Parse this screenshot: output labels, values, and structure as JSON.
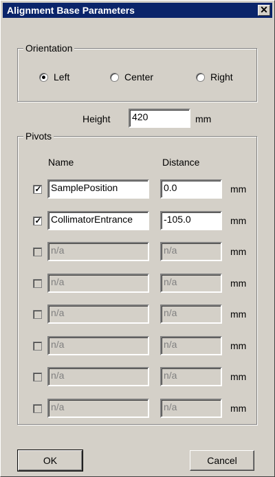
{
  "window": {
    "title": "Alignment Base Parameters",
    "close_glyph": "✕"
  },
  "orientation": {
    "legend": "Orientation",
    "options": [
      {
        "label": "Left",
        "checked": true
      },
      {
        "label": "Center",
        "checked": false
      },
      {
        "label": "Right",
        "checked": false
      }
    ]
  },
  "height": {
    "label": "Height",
    "value": "420",
    "unit": "mm"
  },
  "pivots": {
    "legend": "Pivots",
    "col_name": "Name",
    "col_distance": "Distance",
    "rows": [
      {
        "checked": true,
        "name": "SamplePosition",
        "distance": "0.0",
        "unit": "mm",
        "enabled": true
      },
      {
        "checked": true,
        "name": "CollimatorEntrance",
        "distance": "-105.0",
        "unit": "mm",
        "enabled": true
      },
      {
        "checked": false,
        "name": "n/a",
        "distance": "n/a",
        "unit": "mm",
        "enabled": false
      },
      {
        "checked": false,
        "name": "n/a",
        "distance": "n/a",
        "unit": "mm",
        "enabled": false
      },
      {
        "checked": false,
        "name": "n/a",
        "distance": "n/a",
        "unit": "mm",
        "enabled": false
      },
      {
        "checked": false,
        "name": "n/a",
        "distance": "n/a",
        "unit": "mm",
        "enabled": false
      },
      {
        "checked": false,
        "name": "n/a",
        "distance": "n/a",
        "unit": "mm",
        "enabled": false
      },
      {
        "checked": false,
        "name": "n/a",
        "distance": "n/a",
        "unit": "mm",
        "enabled": false
      }
    ]
  },
  "buttons": {
    "ok": "OK",
    "cancel": "Cancel"
  }
}
